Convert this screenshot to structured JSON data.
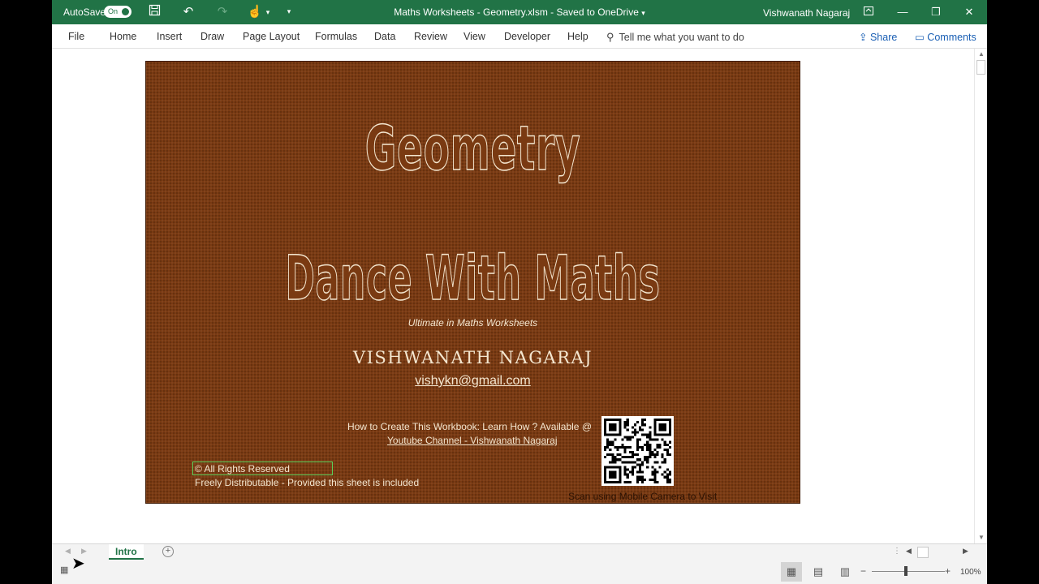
{
  "titlebar": {
    "autosave_label": "AutoSave",
    "autosave_state": "On",
    "title": "Maths Worksheets - Geometry.xlsm  -  Saved to OneDrive",
    "user": "Vishwanath Nagaraj",
    "accent": "#217346"
  },
  "ribbon": {
    "tabs": [
      "File",
      "Home",
      "Insert",
      "Draw",
      "Page Layout",
      "Formulas",
      "Data",
      "Review",
      "View",
      "Developer",
      "Help"
    ],
    "tell_me": "Tell me what you want to do",
    "share": "Share",
    "comments": "Comments"
  },
  "cover": {
    "title": "Geometry",
    "brand": "Dance With Maths",
    "tagline": "Ultimate in Maths Worksheets",
    "author": "VISHWANATH NAGARAJ",
    "email": "vishykn@gmail.com",
    "howto": "How to Create This Workbook: Learn How ? Available @",
    "youtube": "Youtube Channel - Vishwanath Nagaraj",
    "copyright": "© All Rights Reserved",
    "freely": "Freely Distributable - Provided this sheet is included",
    "scan": "Scan using Mobile Camera to Visit",
    "background": "#7a3a12"
  },
  "sheets": {
    "active": "Intro"
  },
  "status": {
    "zoom": "100%"
  }
}
